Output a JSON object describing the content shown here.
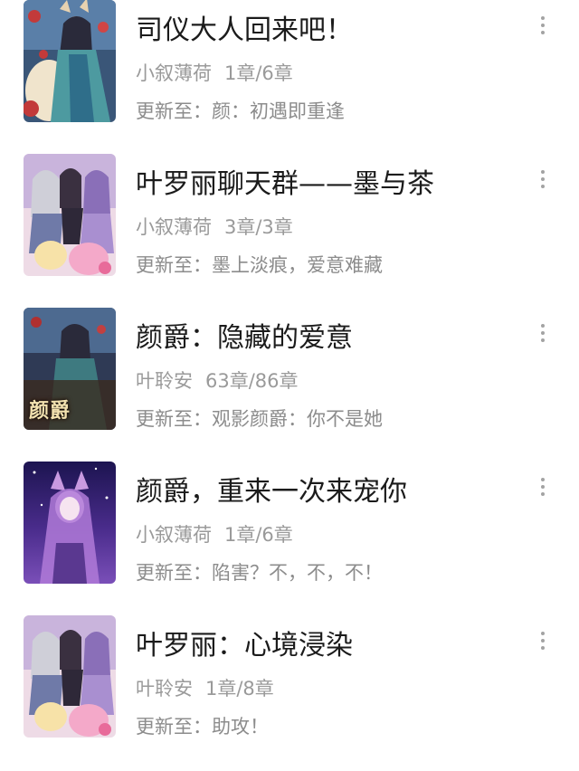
{
  "books": [
    {
      "title": "司仪大人回来吧！",
      "author": "小叙薄荷",
      "chapters": "1章/6章",
      "update_prefix": "更新至：",
      "update_title": "颜：初遇即重逢",
      "cover_icon": "anime-cover-fox-ears",
      "cover_colors": [
        "#2e4a6e",
        "#c23a3a",
        "#e9d7b8",
        "#3f8a8f"
      ]
    },
    {
      "title": "叶罗丽聊天群——墨与茶",
      "author": "小叙薄荷",
      "chapters": "3章/3章",
      "update_prefix": "更新至：",
      "update_title": "墨上淡痕，爱意难藏",
      "cover_icon": "anime-cover-group",
      "cover_colors": [
        "#e8c6d8",
        "#8a6fb8",
        "#f4a9c9",
        "#6f7aa8"
      ]
    },
    {
      "title": "颜爵：隐藏的爱意",
      "author": "叶聆安",
      "chapters": "63章/86章",
      "update_prefix": "更新至：",
      "update_title": "观影颜爵：你不是她",
      "cover_icon": "anime-cover-calligraphy",
      "cover_colors": [
        "#2b3550",
        "#b03030",
        "#3a2a1e",
        "#d8b878"
      ]
    },
    {
      "title": "颜爵，重来一次来宠你",
      "author": "小叙薄荷",
      "chapters": "1章/6章",
      "update_prefix": "更新至：",
      "update_title": "陷害？不，不，不！",
      "cover_icon": "anime-cover-starry-purple",
      "cover_colors": [
        "#1c1450",
        "#6a3fa8",
        "#c99ae0",
        "#f0d8f0"
      ]
    },
    {
      "title": "叶罗丽：心境浸染",
      "author": "叶聆安",
      "chapters": "1章/8章",
      "update_prefix": "更新至：",
      "update_title": "助攻！",
      "cover_icon": "anime-cover-group",
      "cover_colors": [
        "#e8c6d8",
        "#8a6fb8",
        "#f4a9c9",
        "#6f7aa8"
      ]
    }
  ],
  "cover_lettering": "颜爵",
  "more_icon": "more-vertical-icon"
}
